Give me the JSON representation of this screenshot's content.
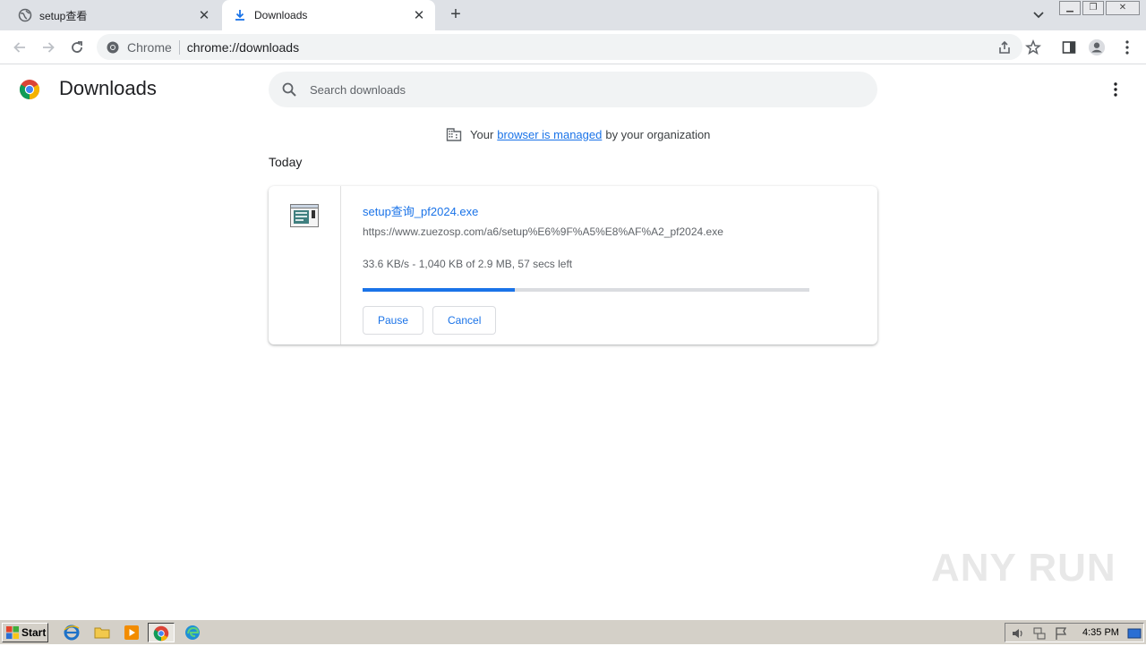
{
  "browser": {
    "tabs": [
      {
        "title": "setup查看",
        "active": false
      },
      {
        "title": "Downloads",
        "active": true
      }
    ],
    "new_tab_label": "+",
    "omnibox": {
      "chip": "Chrome",
      "url": "chrome://downloads"
    }
  },
  "page": {
    "title": "Downloads",
    "search_placeholder": "Search downloads",
    "managed_notice": {
      "before": "Your",
      "link": "browser is managed",
      "after": "by your organization"
    },
    "section_label": "Today",
    "download": {
      "filename": "setup查询_pf2024.exe",
      "url": "https://www.zuezosp.com/a6/setup%E6%9F%A5%E8%AF%A2_pf2024.exe",
      "status": "33.6 KB/s - 1,040 KB of 2.9 MB, 57 secs left",
      "progress_fraction": 0.34,
      "pause_label": "Pause",
      "cancel_label": "Cancel"
    }
  },
  "watermark": "ANY RUN",
  "taskbar": {
    "start_label": "Start",
    "clock": "4:35 PM"
  },
  "colors": {
    "accent": "#1a73e8",
    "tabstrip": "#dee1e6",
    "taskbar": "#d4d0c8"
  }
}
